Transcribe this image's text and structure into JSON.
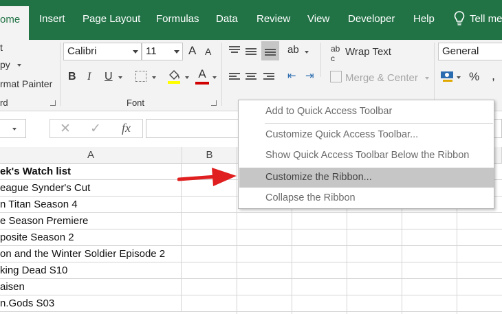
{
  "tabs": [
    "ome",
    "Insert",
    "Page Layout",
    "Formulas",
    "Data",
    "Review",
    "View",
    "Developer",
    "Help",
    "Tell me"
  ],
  "active_tab": "ome",
  "clipboard": {
    "cut_fragment": "t",
    "copy_fragment": "py",
    "format_painter_fragment": "rmat Painter",
    "group_label_fragment": "rd"
  },
  "font": {
    "name": "Calibri",
    "size": "11",
    "group_label": "Font",
    "grow_label": "A",
    "shrink_label": "A",
    "bold": "B",
    "italic": "I",
    "underline": "U"
  },
  "alignment": {
    "wrap_text": "Wrap Text",
    "merge_center": "Merge & Center"
  },
  "number": {
    "format": "General",
    "percent": "%"
  },
  "formula_bar": {
    "fx": "fx",
    "cancel": "✕",
    "enter": "✓"
  },
  "columns": [
    "A",
    "B"
  ],
  "rows": [
    {
      "text": "ek's Watch list",
      "bold": true
    },
    {
      "text": "eague Synder's Cut",
      "bold": false
    },
    {
      "text": "n Titan Season 4",
      "bold": false
    },
    {
      "text": "e Season Premiere",
      "bold": false
    },
    {
      "text": "posite Season 2",
      "bold": false
    },
    {
      "text": "on and the Winter Soldier Episode 2",
      "bold": false
    },
    {
      "text": "king Dead S10",
      "bold": false
    },
    {
      "text": "aisen",
      "bold": false
    },
    {
      "text": "n.Gods S03",
      "bold": false
    }
  ],
  "context_menu": {
    "items": [
      {
        "label": "Add to Quick Access Toolbar",
        "highlighted": false
      },
      {
        "label": "Customize Quick Access Toolbar...",
        "highlighted": false
      },
      {
        "label": "Show Quick Access Toolbar Below the Ribbon",
        "highlighted": false
      },
      {
        "label": "Customize the Ribbon...",
        "highlighted": true
      },
      {
        "label": "Collapse the Ribbon",
        "highlighted": false
      }
    ]
  },
  "colors": {
    "accent": "#217346",
    "arrow": "#e02020",
    "highlight": "#c6c6c6",
    "font_color": "#d00000",
    "fill_color": "#ffff00"
  }
}
